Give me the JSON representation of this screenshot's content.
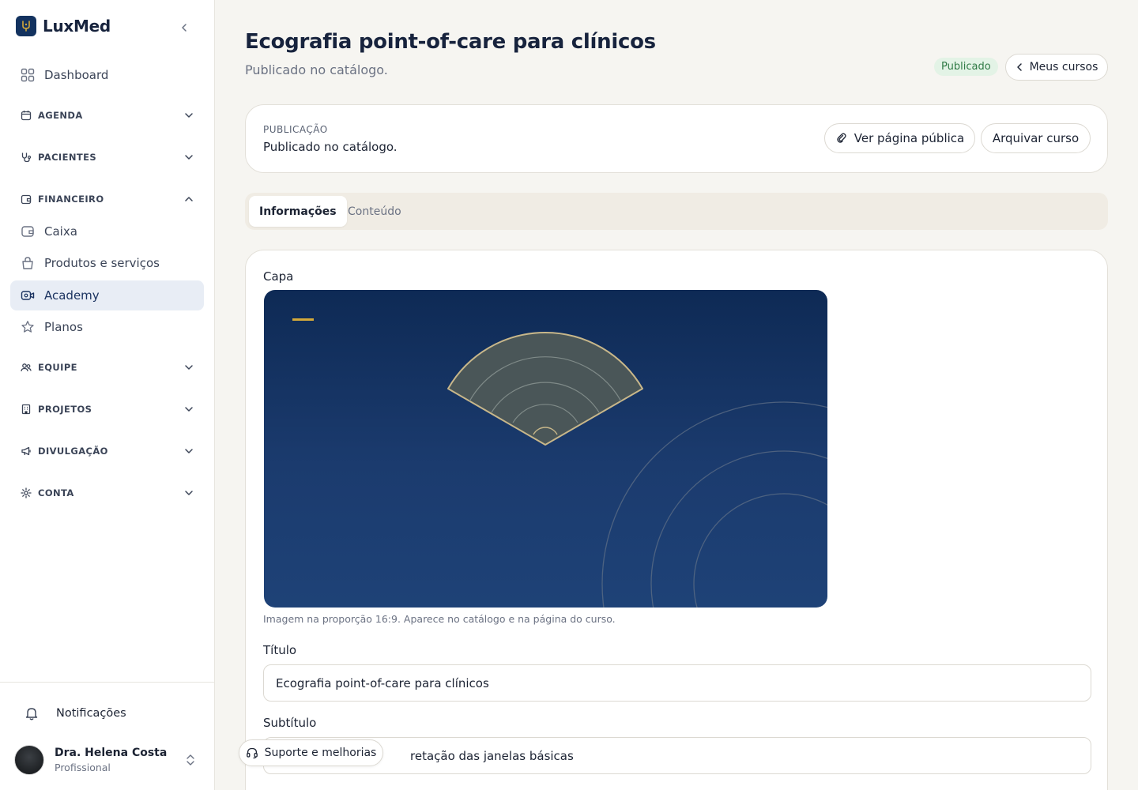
{
  "app": {
    "name": "LuxMed"
  },
  "sidebar": {
    "items": [
      {
        "label": "Dashboard",
        "icon": "grid-icon"
      },
      {
        "label": "AGENDA",
        "icon": "calendar-icon"
      },
      {
        "label": "PACIENTES",
        "icon": "stethoscope-icon"
      },
      {
        "label": "FINANCEIRO",
        "icon": "wallet-icon"
      },
      {
        "label": "Caixa",
        "icon": "wallet-icon"
      },
      {
        "label": "Produtos e serviços",
        "icon": "bag-icon"
      },
      {
        "label": "Academy",
        "icon": "video-icon",
        "active": true
      },
      {
        "label": "Planos",
        "icon": "star-icon"
      },
      {
        "label": "EQUIPE",
        "icon": "users-icon"
      },
      {
        "label": "PROJETOS",
        "icon": "building-icon"
      },
      {
        "label": "DIVULGAÇÃO",
        "icon": "megaphone-icon"
      },
      {
        "label": "CONTA",
        "icon": "gear-icon"
      }
    ],
    "notifications_label": "Notificações",
    "user": {
      "name": "Dra. Helena Costa",
      "role": "Profissional"
    }
  },
  "header": {
    "title": "Ecografia point-of-care para clínicos",
    "subtitle": "Publicado no catálogo.",
    "status": "Publicado",
    "back_label": "Meus cursos"
  },
  "publication": {
    "kicker": "PUBLICAÇÃO",
    "text": "Publicado no catálogo.",
    "view_public_label": "Ver página pública",
    "archive_label": "Arquivar curso"
  },
  "tabs": [
    {
      "label": "Informações",
      "active": true
    },
    {
      "label": "Conteúdo",
      "active": false
    }
  ],
  "form": {
    "cover_label": "Capa",
    "cover_hint": "Imagem na proporção 16:9. Aparece no catálogo e na página do curso.",
    "title_label": "Título",
    "title_value": "Ecografia point-of-care para clínicos",
    "subtitle_label": "Subtítulo",
    "subtitle_value_visible": "retação das janelas básicas"
  },
  "support": {
    "label": "Suporte e melhorias"
  },
  "colors": {
    "brand_navy": "#13325f",
    "accent_gold": "#d4a93a",
    "status_green_bg": "#e3f3e6",
    "status_green_text": "#2f7a45",
    "active_nav_bg": "#e8edf5"
  }
}
